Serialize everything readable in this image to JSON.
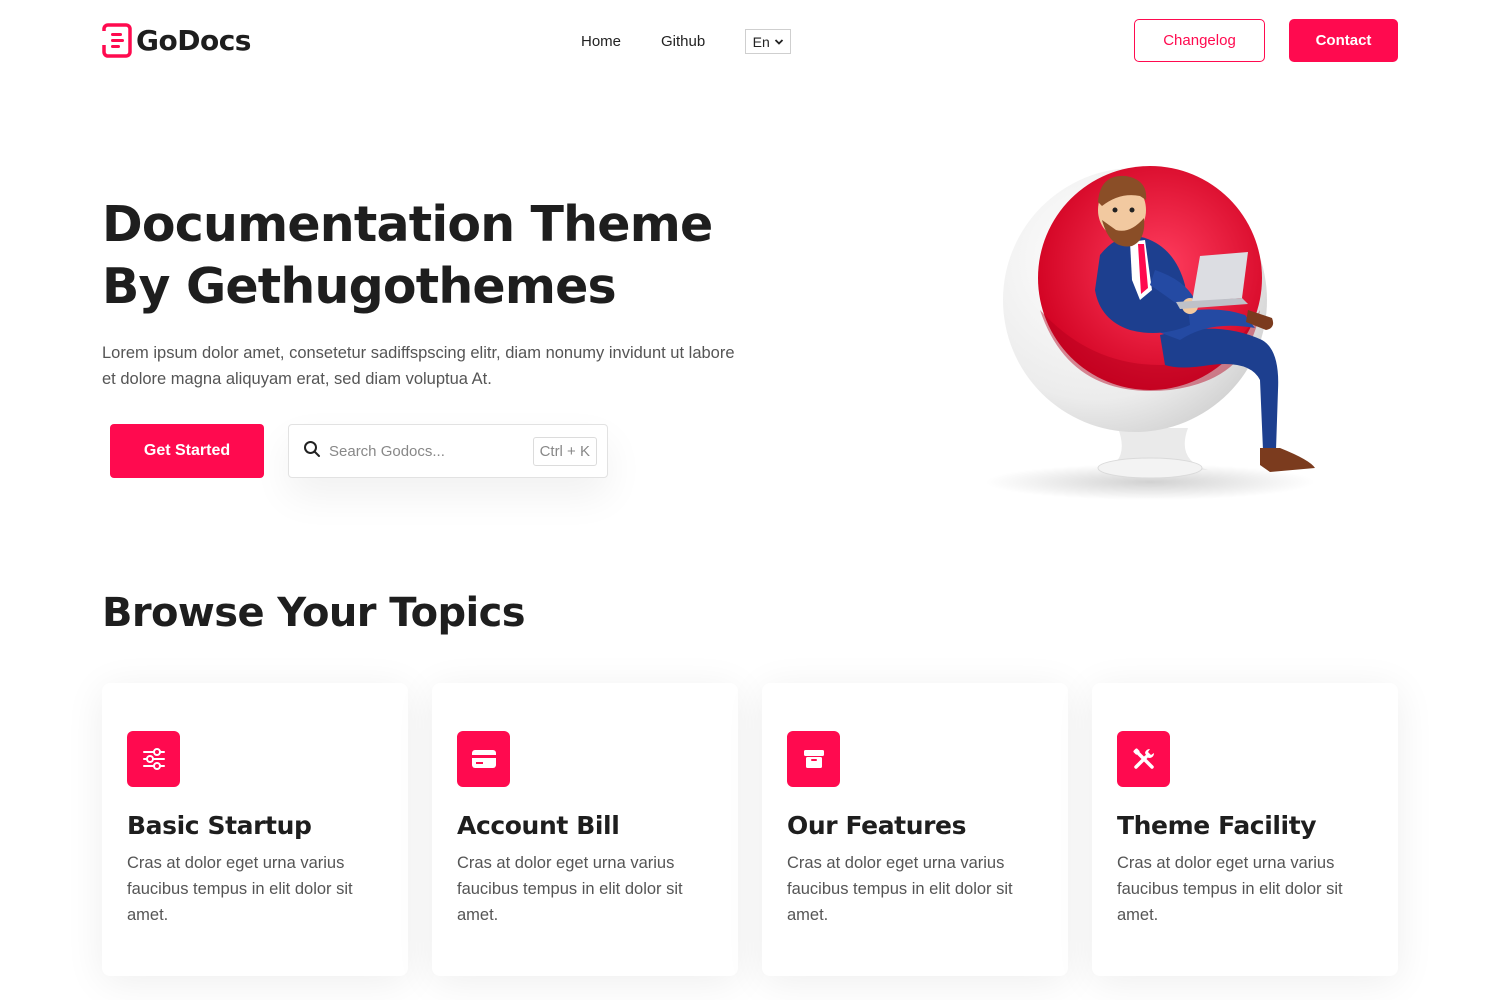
{
  "header": {
    "logo_text": "GoDocs",
    "nav": [
      {
        "label": "Home"
      },
      {
        "label": "Github"
      }
    ],
    "language": "En",
    "changelog_label": "Changelog",
    "contact_label": "Contact"
  },
  "hero": {
    "title_line1": "Documentation Theme",
    "title_line2": "By Gethugothemes",
    "description": "Lorem ipsum dolor amet, consetetur sadiffspscing elitr, diam nonumy invidunt ut labore et dolore magna aliquyam erat, sed diam voluptua At.",
    "cta_label": "Get Started",
    "search_placeholder": "Search Godocs...",
    "search_shortcut": "Ctrl + K"
  },
  "topics": {
    "title": "Browse Your Topics",
    "cards": [
      {
        "title": "Basic Startup",
        "description": "Cras at dolor eget urna varius faucibus tempus in elit dolor sit amet.",
        "icon": "sliders-icon"
      },
      {
        "title": "Account Bill",
        "description": "Cras at dolor eget urna varius faucibus tempus in elit dolor sit amet.",
        "icon": "credit-card-icon"
      },
      {
        "title": "Our Features",
        "description": "Cras at dolor eget urna varius faucibus tempus in elit dolor sit amet.",
        "icon": "box-icon"
      },
      {
        "title": "Theme Facility",
        "description": "Cras at dolor eget urna varius faucibus tempus in elit dolor sit amet.",
        "icon": "tools-icon"
      }
    ]
  },
  "colors": {
    "accent": "#ff0a4f",
    "heading": "#1e1e1e",
    "body_text": "#555555"
  }
}
